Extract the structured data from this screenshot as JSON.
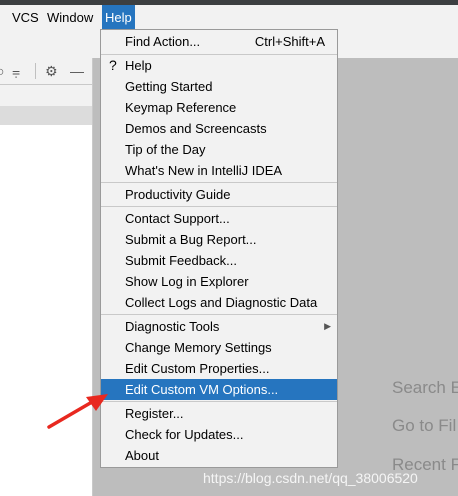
{
  "menubar": {
    "items": [
      {
        "label": "VCS"
      },
      {
        "label": "Window"
      },
      {
        "label": "Help"
      }
    ]
  },
  "toolbar": {
    "icons": [
      "collapse-icon",
      "settings-gear-icon",
      "minimize-icon"
    ]
  },
  "editor_hints": {
    "search": "Search E",
    "goto": "Go to Fil",
    "recent": "Recent Fi"
  },
  "help_menu": {
    "groups": [
      [
        {
          "label": "Find Action...",
          "shortcut": "Ctrl+Shift+A"
        }
      ],
      [
        {
          "label": "Help",
          "icon": "?"
        },
        {
          "label": "Getting Started"
        },
        {
          "label": "Keymap Reference"
        },
        {
          "label": "Demos and Screencasts"
        },
        {
          "label": "Tip of the Day"
        },
        {
          "label": "What's New in IntelliJ IDEA"
        }
      ],
      [
        {
          "label": "Productivity Guide"
        }
      ],
      [
        {
          "label": "Contact Support..."
        },
        {
          "label": "Submit a Bug Report..."
        },
        {
          "label": "Submit Feedback..."
        },
        {
          "label": "Show Log in Explorer"
        },
        {
          "label": "Collect Logs and Diagnostic Data"
        }
      ],
      [
        {
          "label": "Diagnostic Tools",
          "submenu": true
        },
        {
          "label": "Change Memory Settings"
        },
        {
          "label": "Edit Custom Properties..."
        },
        {
          "label": "Edit Custom VM Options...",
          "selected": true
        }
      ],
      [
        {
          "label": "Register..."
        },
        {
          "label": "Check for Updates..."
        },
        {
          "label": "About"
        }
      ]
    ]
  },
  "colors": {
    "highlight": "#2675bf",
    "annotation_arrow": "#e8281f"
  },
  "watermark": "https://blog.csdn.net/qq_38006520"
}
